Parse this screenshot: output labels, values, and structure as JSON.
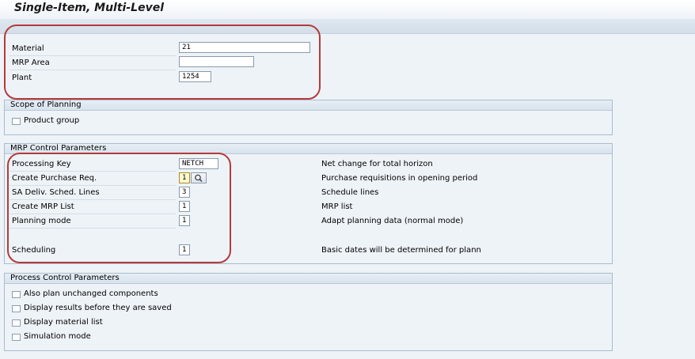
{
  "header": {
    "title": "Single-Item, Multi-Level"
  },
  "top_fields": [
    {
      "label": "Material",
      "value": "21"
    },
    {
      "label": "MRP Area",
      "value": ""
    },
    {
      "label": "Plant",
      "value": "1254"
    }
  ],
  "scope_of_planning": {
    "title": "Scope of Planning",
    "product_group_label": "Product group",
    "product_group_checked": false
  },
  "mrp_control": {
    "title": "MRP Control Parameters",
    "rows": [
      {
        "label": "Processing Key",
        "value": "NETCH",
        "description": "Net change for total horizon"
      },
      {
        "label": "Create Purchase Req.",
        "value": "1",
        "description": "Purchase requisitions in opening period"
      },
      {
        "label": "SA Deliv. Sched. Lines",
        "value": "3",
        "description": "Schedule lines"
      },
      {
        "label": "Create MRP List",
        "value": "1",
        "description": "MRP list"
      },
      {
        "label": "Planning mode",
        "value": "1",
        "description": "Adapt planning data (normal mode)"
      },
      {
        "label": "Scheduling",
        "value": "1",
        "description": "Basic dates will be determined for plann"
      }
    ]
  },
  "process_control": {
    "title": "Process Control Parameters",
    "options": [
      {
        "label": "Also plan unchanged components",
        "checked": false
      },
      {
        "label": "Display results before they are saved",
        "checked": false
      },
      {
        "label": "Display material list",
        "checked": false
      },
      {
        "label": "Simulation mode",
        "checked": false
      }
    ]
  },
  "colors": {
    "background": "#eef3f8",
    "group_border": "#a9bccd",
    "callout_red": "#b53a3a",
    "required_field": "#fffbd0"
  },
  "icons": {
    "search_help": "magnifier-icon"
  }
}
